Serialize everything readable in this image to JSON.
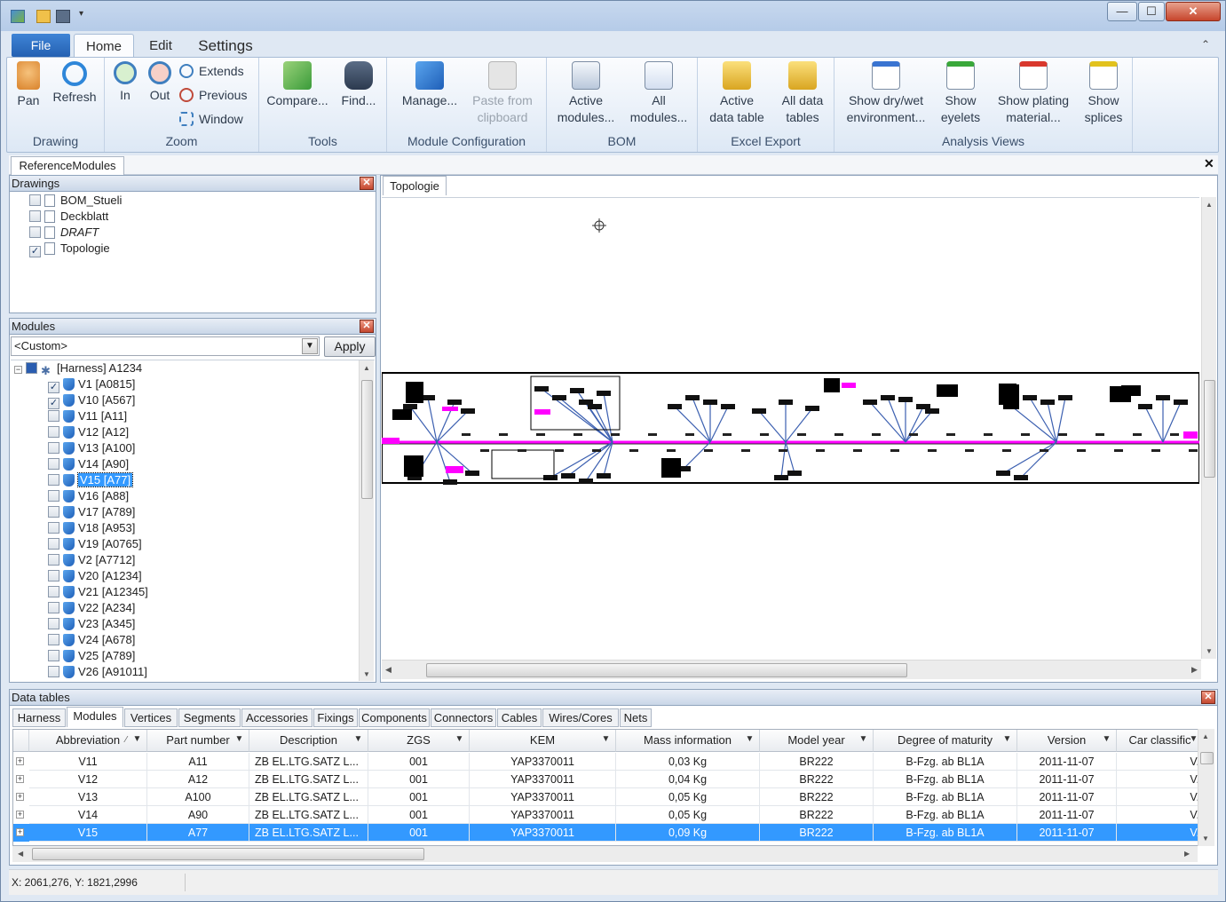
{
  "ribbon": {
    "tabs": {
      "file": "File",
      "home": "Home",
      "edit": "Edit",
      "settings": "Settings"
    },
    "groups": {
      "drawing": {
        "label": "Drawing",
        "pan": "Pan",
        "refresh": "Refresh"
      },
      "zoom": {
        "label": "Zoom",
        "in": "In",
        "out": "Out",
        "extends": "Extends",
        "previous": "Previous",
        "window": "Window"
      },
      "tools": {
        "label": "Tools",
        "compare": "Compare...",
        "find": "Find..."
      },
      "module_config": {
        "label": "Module Configuration",
        "manage": "Manage...",
        "paste_line1": "Paste from",
        "paste_line2": "clipboard"
      },
      "bom": {
        "label": "BOM",
        "active_line1": "Active",
        "active_line2": "modules...",
        "all_line1": "All",
        "all_line2": "modules..."
      },
      "excel": {
        "label": "Excel Export",
        "active_line1": "Active",
        "active_line2": "data table",
        "all_line1": "All data",
        "all_line2": "tables"
      },
      "analysis": {
        "label": "Analysis Views",
        "drywet_line1": "Show dry/wet",
        "drywet_line2": "environment...",
        "eyelets_line1": "Show",
        "eyelets_line2": "eyelets",
        "plating_line1": "Show plating",
        "plating_line2": "material...",
        "splices_line1": "Show",
        "splices_line2": "splices"
      }
    }
  },
  "document_tab": "ReferenceModules",
  "drawings_panel": {
    "title": "Drawings",
    "items": [
      {
        "label": "BOM_Stueli",
        "checked": false
      },
      {
        "label": "Deckblatt",
        "checked": false
      },
      {
        "label": "DRAFT",
        "checked": false
      },
      {
        "label": "Topologie",
        "checked": true
      }
    ]
  },
  "modules_panel": {
    "title": "Modules",
    "filter_value": "<Custom>",
    "apply_label": "Apply",
    "root": "[Harness] A1234",
    "items": [
      {
        "label": "V1 [A0815]",
        "checked": true
      },
      {
        "label": "V10 [A567]",
        "checked": true
      },
      {
        "label": "V11 [A11]",
        "checked": false
      },
      {
        "label": "V12 [A12]",
        "checked": false
      },
      {
        "label": "V13 [A100]",
        "checked": false
      },
      {
        "label": "V14 [A90]",
        "checked": false
      },
      {
        "label": "V15 [A77]",
        "checked": false,
        "selected": true
      },
      {
        "label": "V16 [A88]",
        "checked": false
      },
      {
        "label": "V17 [A789]",
        "checked": false
      },
      {
        "label": "V18 [A953]",
        "checked": false
      },
      {
        "label": "V19 [A0765]",
        "checked": false
      },
      {
        "label": "V2 [A7712]",
        "checked": false
      },
      {
        "label": "V20 [A1234]",
        "checked": false
      },
      {
        "label": "V21 [A12345]",
        "checked": false
      },
      {
        "label": "V22 [A234]",
        "checked": false
      },
      {
        "label": "V23 [A345]",
        "checked": false
      },
      {
        "label": "V24 [A678]",
        "checked": false
      },
      {
        "label": "V25 [A789]",
        "checked": false
      },
      {
        "label": "V26 [A91011]",
        "checked": false
      }
    ]
  },
  "drawing_tab": "Topologie",
  "data_tables": {
    "title": "Data tables",
    "tabs": [
      "Harness",
      "Modules",
      "Vertices",
      "Segments",
      "Accessories",
      "Fixings",
      "Components",
      "Connectors",
      "Cables",
      "Wires/Cores",
      "Nets"
    ],
    "active_tab": "Modules",
    "columns": [
      "Abbreviation",
      "Part number",
      "Description",
      "ZGS",
      "KEM",
      "Mass information",
      "Model year",
      "Degree of maturity",
      "Version",
      "Car classific"
    ],
    "rows": [
      [
        "V11",
        "A11",
        "ZB EL.LTG.SATZ L...",
        "001",
        "YAP3370011",
        "0,03 Kg",
        "BR222",
        "B-Fzg. ab BL1A",
        "2011-11-07",
        "V."
      ],
      [
        "V12",
        "A12",
        "ZB EL.LTG.SATZ L...",
        "001",
        "YAP3370011",
        "0,04 Kg",
        "BR222",
        "B-Fzg. ab BL1A",
        "2011-11-07",
        "V."
      ],
      [
        "V13",
        "A100",
        "ZB EL.LTG.SATZ L...",
        "001",
        "YAP3370011",
        "0,05 Kg",
        "BR222",
        "B-Fzg. ab BL1A",
        "2011-11-07",
        "V."
      ],
      [
        "V14",
        "A90",
        "ZB EL.LTG.SATZ L...",
        "001",
        "YAP3370011",
        "0,05 Kg",
        "BR222",
        "B-Fzg. ab BL1A",
        "2011-11-07",
        "V."
      ],
      [
        "V15",
        "A77",
        "ZB EL.LTG.SATZ L...",
        "001",
        "YAP3370011",
        "0,09 Kg",
        "BR222",
        "B-Fzg. ab BL1A",
        "2011-11-07",
        "V."
      ]
    ],
    "selected_row": 4
  },
  "status": {
    "coords": "X: 2061,276, Y: 1821,2996"
  },
  "colors": {
    "accent": "#3399ff",
    "harness_main": "#ff00ff",
    "harness_branch": "#3b5fb0",
    "file_tab": "#2a69be"
  }
}
